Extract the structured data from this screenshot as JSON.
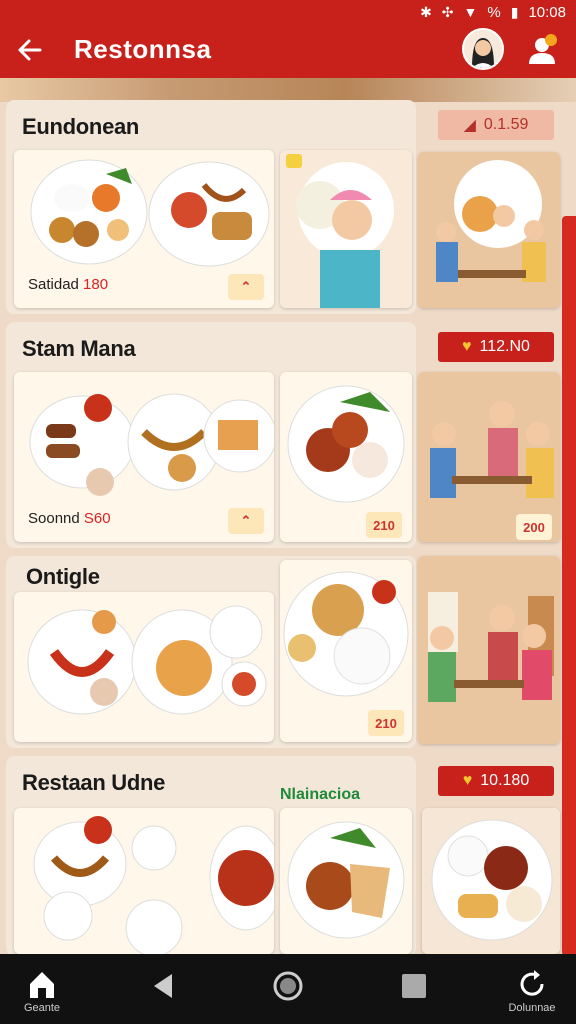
{
  "status_bar": {
    "icons": [
      "bluetooth-icon",
      "vibrate-icon",
      "wifi-icon",
      "battery-icon"
    ],
    "percent": "%",
    "time": "10:08"
  },
  "app_bar": {
    "title": "Restonnsa",
    "back_icon": "arrow-left-icon",
    "user_icon": "user-chat-icon"
  },
  "sections": [
    {
      "title": "Eundonean",
      "caption_text": "Satidad",
      "caption_price": "180",
      "price_badge": "0.1.59"
    },
    {
      "title": "Stam Mana",
      "caption_text": "Soonnd",
      "caption_price": "S60",
      "price_badge": "112.N0",
      "tag_value": "210",
      "scene_tag": "200"
    },
    {
      "title": "Ontigle",
      "tag_value": "210"
    },
    {
      "title": "Restaan Udne",
      "side_label": "Nlainacioa",
      "price_badge": "10.180"
    }
  ],
  "nav_bar": {
    "home_label": "Geante",
    "refresh_label": "Dolunnae"
  },
  "colors": {
    "primary": "#c8201a",
    "background": "#efd9c7",
    "card": "#fff7ea"
  }
}
